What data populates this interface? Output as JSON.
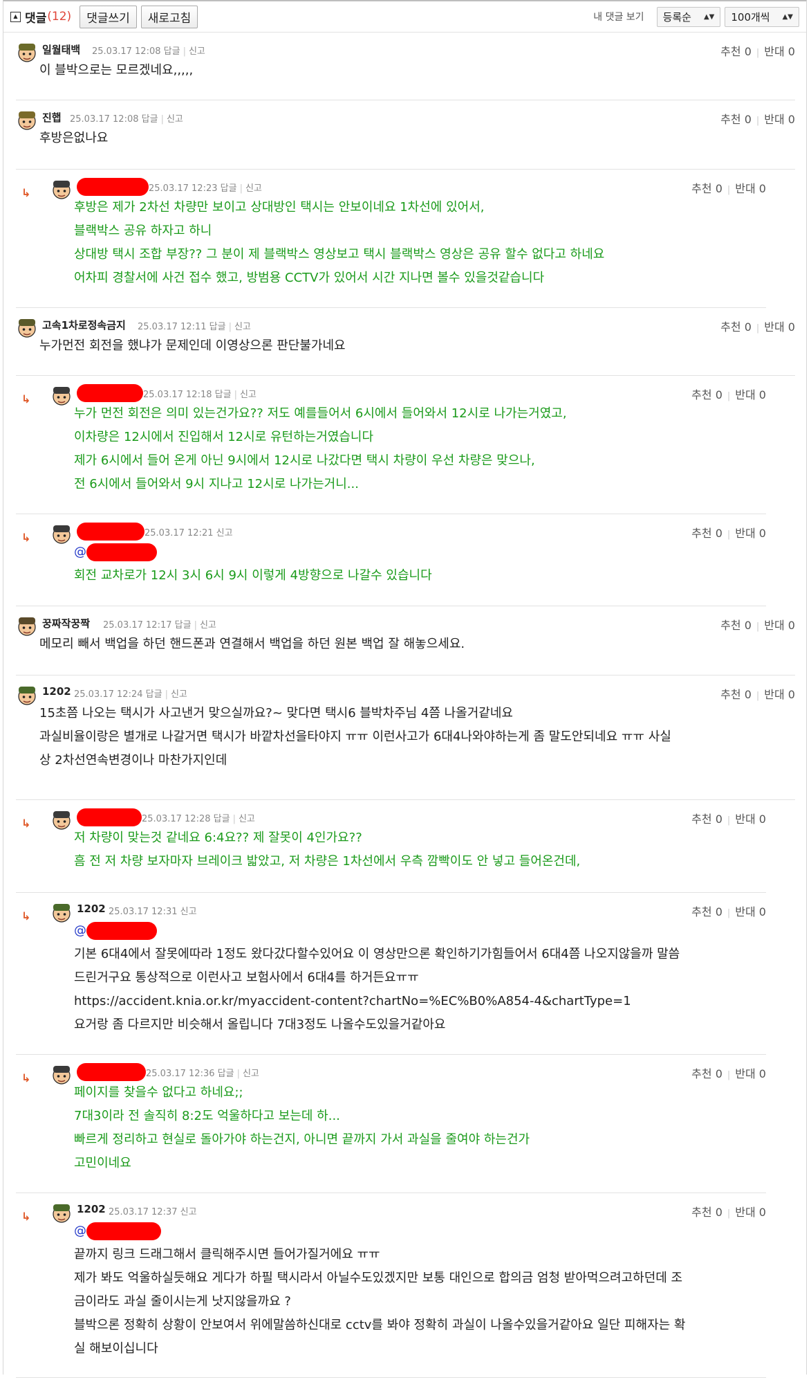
{
  "toolbar": {
    "title": "댓글",
    "count": "(12)",
    "write_label": "댓글쓰기",
    "refresh_label": "새로고침",
    "my_comments_label": "내 댓글 보기",
    "sort_value": "등록순",
    "per_page_value": "100개씩"
  },
  "labels": {
    "reply": "답글",
    "report": "신고",
    "recommend": "추천 0",
    "oppose": "반대 0"
  },
  "comments": [
    {
      "nick": "일월태백",
      "time": "25.03.17 12:08",
      "lines": [
        "이 블박으로는 모르겠네요,,,,,"
      ]
    },
    {
      "nick": "진햅",
      "time": "25.03.17 12:08",
      "lines": [
        "후방은없나요"
      ]
    },
    {
      "nick": "",
      "time": "25.03.17 12:23",
      "lines": [
        "후방은 제가 2차선 차량만 보이고 상대방인 택시는 안보이네요 1차선에 있어서,",
        "블랙박스 공유 하자고 하니",
        "상대방 택시 조합 부장?? 그 분이 제 블랙박스 영상보고 택시 블랙박스 영상은 공유 할수 없다고 하네요",
        "어차피 경찰서에 사건 접수 했고, 방범용 CCTV가 있어서 시간 지나면 볼수 있을것같습니다"
      ]
    },
    {
      "nick": "고속1차로정속금지",
      "time": "25.03.17 12:11",
      "lines": [
        "누가먼전 회전을 했냐가 문제인데 이영상으론 판단불가네요"
      ]
    },
    {
      "nick": "",
      "time": "25.03.17 12:18",
      "lines": [
        "누가 먼전 회전은 의미 있는건가요?? 저도 예를들어서 6시에서 들어와서 12시로 나가는거였고,",
        "이차량은 12시에서 진입해서 12시로 유턴하는거였습니다",
        "제가 6시에서 들어 온게 아닌 9시에서 12시로 나갔다면 택시 차량이 우선 차량은 맞으나,",
        "전 6시에서 들어와서 9시 지나고 12시로 나가는거니..."
      ]
    },
    {
      "nick": "",
      "time": "25.03.17 12:21",
      "mention": "@",
      "lines": [
        "회전 교차로가 12시 3시 6시 9시 이렇게 4방향으로 나갈수 있습니다"
      ]
    },
    {
      "nick": "꿍짜작꿍짝",
      "time": "25.03.17 12:17",
      "lines": [
        "메모리 빼서 백업을 하던 핸드폰과 연결해서 백업을 하던 원본 백업 잘 해놓으세요."
      ]
    },
    {
      "nick": "1202",
      "time": "25.03.17 12:24",
      "lines": [
        "15초쯤 나오는 택시가 사고낸거 맞으실까요?~ 맞다면 택시6 블박차주님 4쯤 나올거같네요",
        "과실비율이랑은 별개로 나갈거면 택시가 바깥차선을타야지 ㅠㅠ 이런사고가 6대4나와야하는게 좀 말도안되네요 ㅠㅠ 사실",
        "상 2차선연속변경이나 마찬가지인데"
      ]
    },
    {
      "nick": "",
      "time": "25.03.17 12:28",
      "lines": [
        "저 차량이 맞는것 같네요 6:4요?? 제 잘못이 4인가요??",
        "흠 전 저 차량 보자마자 브레이크 밟았고, 저 차량은 1차선에서 우측 깜빡이도 안 넣고 들어온건데,"
      ]
    },
    {
      "nick": "1202",
      "time": "25.03.17 12:31",
      "mention": "@",
      "lines": [
        "기본 6대4에서 잘못에따라 1정도 왔다갔다할수있어요 이 영상만으론 확인하기가힘들어서 6대4쯤 나오지않을까 말씀",
        "드린거구요 통상적으로 이런사고 보험사에서 6대4를 하거든요ㅠㅠ",
        "https://accident.knia.or.kr/myaccident-content?chartNo=%EC%B0%A854-4&chartType=1",
        "요거랑 좀 다르지만 비슷해서 올립니다 7대3정도 나올수도있을거같아요"
      ]
    },
    {
      "nick": "",
      "time": "25.03.17 12:36",
      "lines": [
        "페이지를 찾을수 없다고 하네요;;",
        "7대3이라 전 솔직히 8:2도 억울하다고 보는데 하...",
        "빠르게 정리하고 현실로 돌아가야 하는건지, 아니면 끝까지 가서 과실을 줄여야 하는건가",
        "고민이네요"
      ]
    },
    {
      "nick": "1202",
      "time": "25.03.17 12:37",
      "mention": "@",
      "lines": [
        "끝까지 링크 드래그해서 클릭해주시면 들어가질거에요 ㅠㅠ",
        "제가 봐도 억울하실듯해요 게다가 하필 택시라서 아닐수도있겠지만 보통 대인으로 합의금 엄청 받아먹으려고하던데 조",
        "금이라도 과실 줄이시는게 낫지않을까요 ?",
        "블박으론 정확히 상황이 안보여서 위에말씀하신대로 cctv를 봐야 정확히 과실이 나올수있을거같아요 일단 피해자는 확",
        "실 해보이십니다"
      ]
    }
  ]
}
